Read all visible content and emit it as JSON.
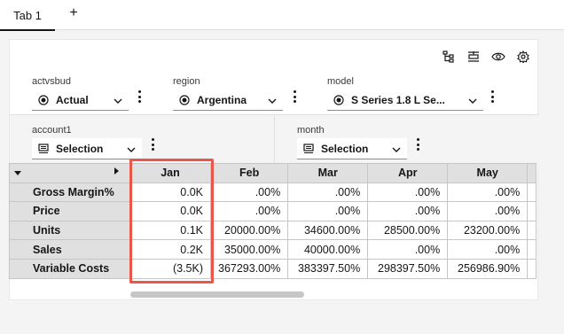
{
  "tabs": [
    {
      "label": "Tab 1"
    }
  ],
  "add_tab": "+",
  "toolbar_icons": [
    "hierarchy-icon",
    "insert-row-icon",
    "view-icon",
    "settings-icon"
  ],
  "filters": {
    "actvsbud": {
      "label": "actvsbud",
      "value": "Actual"
    },
    "region": {
      "label": "region",
      "value": "Argentina"
    },
    "model": {
      "label": "model",
      "value": "S Series 1.8 L Se..."
    },
    "account1": {
      "label": "account1",
      "value": "Selection"
    },
    "month": {
      "label": "month",
      "value": "Selection"
    }
  },
  "grid": {
    "columns": [
      "Jan",
      "Feb",
      "Mar",
      "Apr",
      "May"
    ],
    "rows": [
      {
        "label": "Gross Margin%",
        "values": [
          "0.0K",
          ".00%",
          ".00%",
          ".00%",
          ".00%"
        ]
      },
      {
        "label": "Price",
        "values": [
          "0.0K",
          ".00%",
          ".00%",
          ".00%",
          ".00%"
        ]
      },
      {
        "label": "Units",
        "values": [
          "0.1K",
          "20000.00%",
          "34600.00%",
          "28500.00%",
          "23200.00%"
        ]
      },
      {
        "label": "Sales",
        "values": [
          "0.2K",
          "35000.00%",
          "40000.00%",
          ".00%",
          ".00%"
        ]
      },
      {
        "label": "Variable Costs",
        "values": [
          "(3.5K)",
          "367293.00%",
          "383397.50%",
          "298397.50%",
          "256986.90%"
        ]
      }
    ]
  },
  "highlight_color": "#e8574a"
}
